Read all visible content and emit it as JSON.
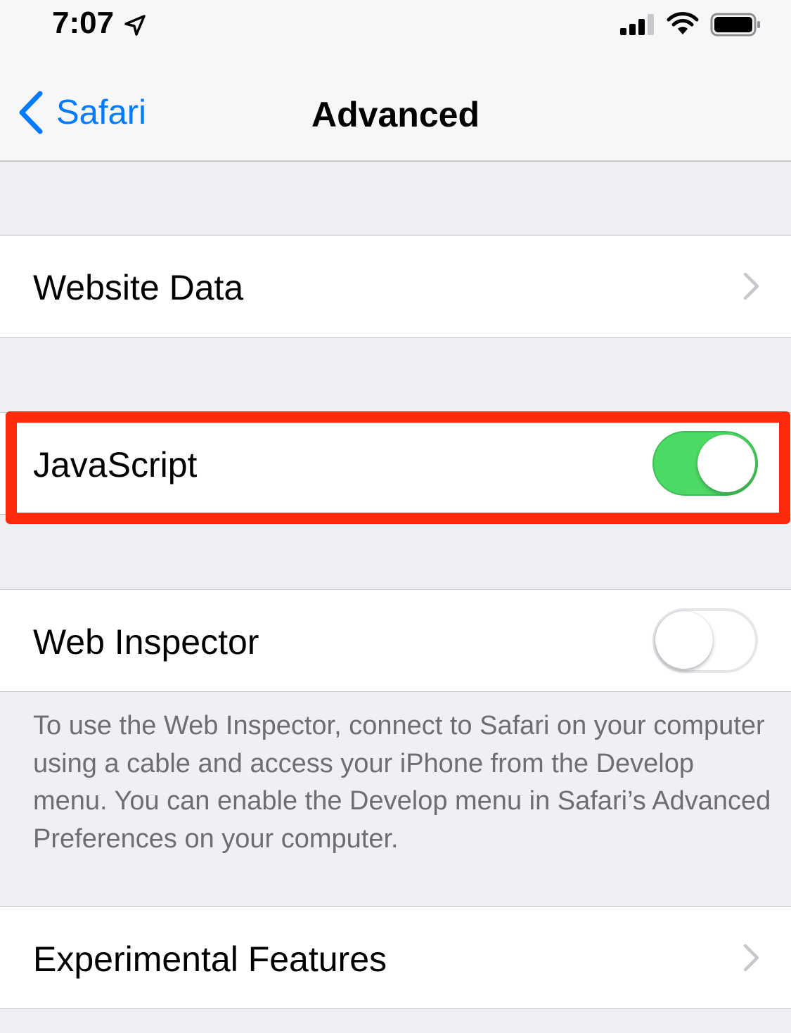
{
  "status_bar": {
    "time": "7:07",
    "icons": [
      "location-arrow-icon",
      "cellular-signal-icon",
      "wifi-icon",
      "battery-icon"
    ]
  },
  "nav": {
    "back_label": "Safari",
    "title": "Advanced",
    "accent_color": "#007aff"
  },
  "cells": {
    "website_data": {
      "label": "Website Data"
    },
    "javascript": {
      "label": "JavaScript",
      "toggle_on": true
    },
    "web_inspector": {
      "label": "Web Inspector",
      "toggle_on": false
    },
    "experimental_features": {
      "label": "Experimental Features"
    }
  },
  "web_inspector_footer": "To use the Web Inspector, connect to Safari on your computer using a cable and access your iPhone from the Develop menu. You can enable the Develop menu in Safari’s Advanced Preferences on your computer.",
  "colors": {
    "toggle_on": "#4cd964",
    "highlight": "#ff2a0a",
    "background": "#efeff4"
  }
}
